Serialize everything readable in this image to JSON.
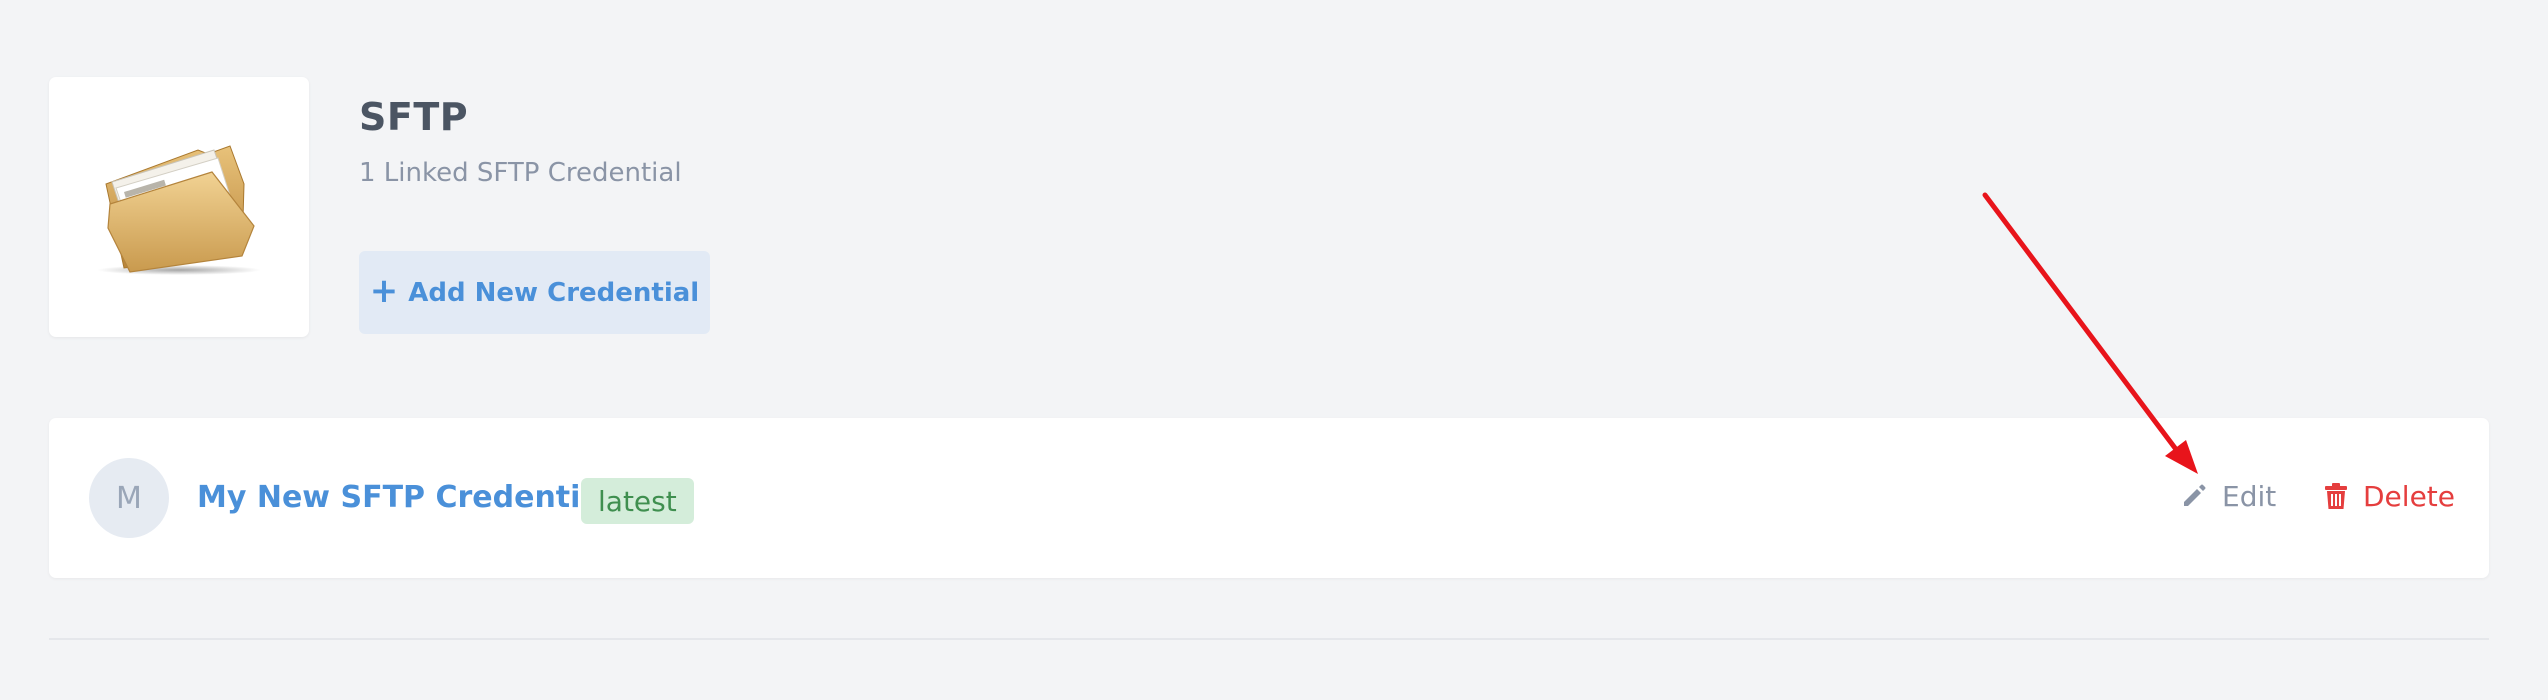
{
  "header": {
    "title": "SFTP",
    "subtitle": "1 Linked SFTP Credential",
    "add_button_label": "Add New Credential",
    "add_button_icon": "plus-icon",
    "logo_icon": "folder-icon"
  },
  "credentials": [
    {
      "avatar_initial": "M",
      "name": "My New SFTP Credential",
      "badge": "latest",
      "edit_label": "Edit",
      "edit_icon": "pencil-icon",
      "delete_label": "Delete",
      "delete_icon": "trash-icon"
    }
  ],
  "colors": {
    "accent": "#4a90d9",
    "danger": "#e53e3e",
    "badge_bg": "#d4edda",
    "badge_text": "#3f8f4f",
    "annotation_arrow": "#e8141b"
  }
}
